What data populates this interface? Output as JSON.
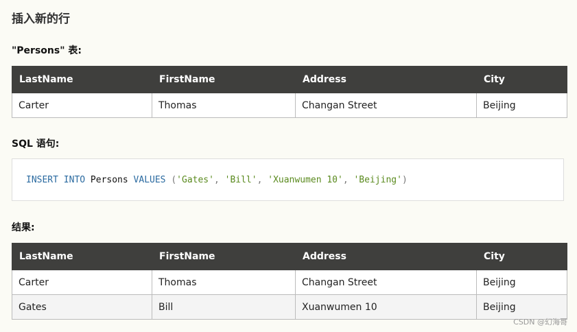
{
  "heading": "插入新的行",
  "persons_label": "\"Persons\" 表:",
  "sql_label": "SQL 语句:",
  "result_label": "结果:",
  "columns": [
    "LastName",
    "FirstName",
    "Address",
    "City"
  ],
  "persons_rows": [
    [
      "Carter",
      "Thomas",
      "Changan Street",
      "Beijing"
    ]
  ],
  "sql": {
    "kw1": "INSERT INTO",
    "table": "Persons",
    "kw2": "VALUES",
    "open": "(",
    "v1": "'Gates'",
    "v2": "'Bill'",
    "v3": "'Xuanwumen 10'",
    "v4": "'Beijing'",
    "comma": ",",
    "close": ")"
  },
  "result_rows": [
    [
      "Carter",
      "Thomas",
      "Changan Street",
      "Beijing"
    ],
    [
      "Gates",
      "Bill",
      "Xuanwumen 10",
      "Beijing"
    ]
  ],
  "watermark": "CSDN @幻海哥"
}
